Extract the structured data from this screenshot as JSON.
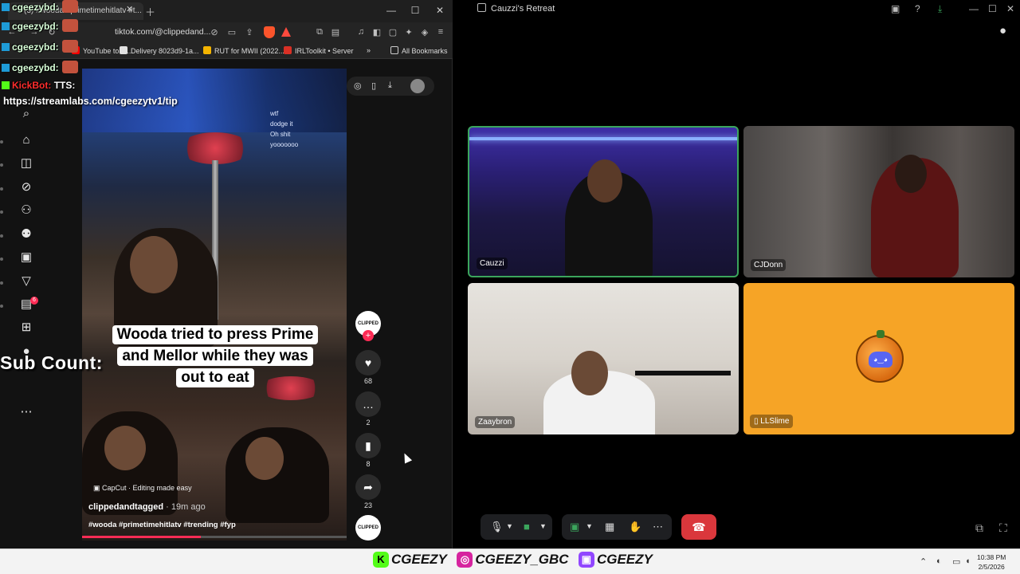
{
  "browser": {
    "tab_title": "(3) #wooda #primetimehitlatv #t...",
    "url": "tiktok.com/@clippedand...",
    "bookmarks": [
      {
        "label": "YouTube to M...",
        "color": "#ff0000"
      },
      {
        "label": "Delivery 8023d9-1a...",
        "color": "#e0e0e0"
      },
      {
        "label": "RUT for MWII (2022...",
        "color": "#f4b400"
      },
      {
        "label": "IRLToolkit • Server",
        "color": "#d93025"
      }
    ],
    "all_bookmarks_label": "All Bookmarks"
  },
  "tiktok": {
    "caption_lines": [
      "Wooda tried to press Prime",
      "and Mellor while they was",
      "out to eat"
    ],
    "capcut_label": "CapCut · Editing made easy",
    "author": "clippedandtagged",
    "posted_ago": " · 19m ago",
    "hashtags": "#wooda #primetimehitlatv #trending #fyp",
    "likes": "68",
    "comments": "2",
    "saves": "8",
    "shares": "23",
    "notifications_count": "6",
    "avatar_text": "CLIPPED",
    "progress_fraction": 0.45,
    "mirrored_chat": [
      "wtf",
      "dodge it",
      "Oh shit",
      "yooooooo"
    ]
  },
  "stream_overlay": {
    "chat": [
      {
        "user": "cgeezybd:"
      },
      {
        "user": "cgeezybd:"
      },
      {
        "user": "cgeezybd:"
      },
      {
        "user": "cgeezybd:"
      }
    ],
    "kickbot_user": "KickBot:",
    "kickbot_msg": "TTS:",
    "tts_url": "https://streamlabs.com/cgeezytv1/tip",
    "sub_count_label": "Sub Count: "
  },
  "discord": {
    "title": "Cauzzi's Retreat",
    "participants": [
      "Cauzzi",
      "CJDonn",
      "Zaaybron",
      "LLSlime"
    ],
    "active_speaker_color": "#3ba55c",
    "hangup_color": "#da373c"
  },
  "taskbar": {
    "handles": [
      {
        "platform": "kick",
        "icon": "K",
        "color": "#53fc18",
        "name": "CGEEZY"
      },
      {
        "platform": "instagram",
        "icon": "◎",
        "color": "#d6249f",
        "name": "CGEEZY_GBC"
      },
      {
        "platform": "twitch",
        "icon": "▣",
        "color": "#9146ff",
        "name": "CGEEZY"
      }
    ],
    "time": "10:38 PM",
    "date": "2/5/2026"
  }
}
